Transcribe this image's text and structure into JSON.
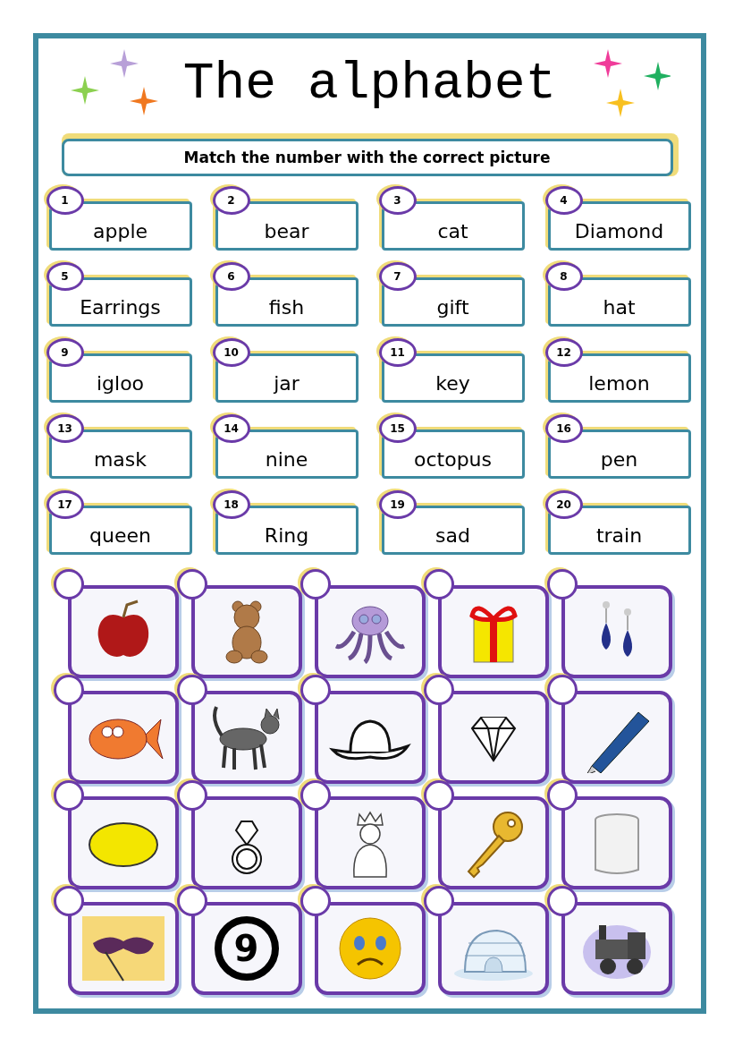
{
  "title": "The alphabet",
  "instruction": "Match the number with the correct picture",
  "words": [
    {
      "number": "1",
      "word": "apple"
    },
    {
      "number": "2",
      "word": "bear"
    },
    {
      "number": "3",
      "word": "cat"
    },
    {
      "number": "4",
      "word": "Diamond"
    },
    {
      "number": "5",
      "word": "Earrings"
    },
    {
      "number": "6",
      "word": "fish"
    },
    {
      "number": "7",
      "word": "gift"
    },
    {
      "number": "8",
      "word": "hat"
    },
    {
      "number": "9",
      "word": "igloo"
    },
    {
      "number": "10",
      "word": "jar"
    },
    {
      "number": "11",
      "word": "key"
    },
    {
      "number": "12",
      "word": "lemon"
    },
    {
      "number": "13",
      "word": "mask"
    },
    {
      "number": "14",
      "word": "nine"
    },
    {
      "number": "15",
      "word": "octopus"
    },
    {
      "number": "16",
      "word": "pen"
    },
    {
      "number": "17",
      "word": "queen"
    },
    {
      "number": "18",
      "word": "Ring"
    },
    {
      "number": "19",
      "word": "sad"
    },
    {
      "number": "20",
      "word": "train"
    }
  ],
  "pictures": [
    {
      "kind": "apple"
    },
    {
      "kind": "bear"
    },
    {
      "kind": "octopus"
    },
    {
      "kind": "gift"
    },
    {
      "kind": "earrings"
    },
    {
      "kind": "fish"
    },
    {
      "kind": "cat"
    },
    {
      "kind": "hat"
    },
    {
      "kind": "diamond"
    },
    {
      "kind": "pen"
    },
    {
      "kind": "lemon"
    },
    {
      "kind": "ring"
    },
    {
      "kind": "queen"
    },
    {
      "kind": "key"
    },
    {
      "kind": "jar"
    },
    {
      "kind": "mask"
    },
    {
      "kind": "number",
      "text": "9"
    },
    {
      "kind": "sad"
    },
    {
      "kind": "igloo"
    },
    {
      "kind": "train"
    }
  ]
}
